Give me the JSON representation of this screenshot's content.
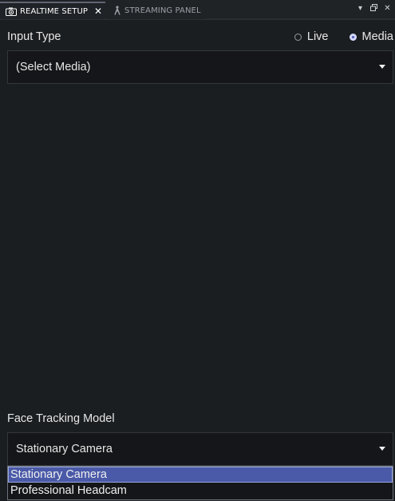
{
  "tabs": [
    {
      "label": "REALTIME SETUP",
      "icon": "camera-icon",
      "active": true
    },
    {
      "label": "STREAMING PANEL",
      "icon": "figure-icon",
      "active": false
    }
  ],
  "tab_controls": {
    "menu_icon": "▾",
    "restore_icon": "🗗",
    "close_icon": "✕"
  },
  "input_type": {
    "label": "Input Type",
    "options": [
      {
        "label": "Live",
        "checked": false
      },
      {
        "label": "Media",
        "checked": true
      }
    ],
    "media_select": {
      "value": "(Select Media)"
    }
  },
  "face_tracking": {
    "label": "Face Tracking Model",
    "selected": "Stationary Camera",
    "options": [
      "Stationary Camera",
      "Professional Headcam"
    ]
  },
  "colors": {
    "background": "#1b1e21",
    "select_bg": "#141619",
    "accent": "#4a5aa8"
  }
}
